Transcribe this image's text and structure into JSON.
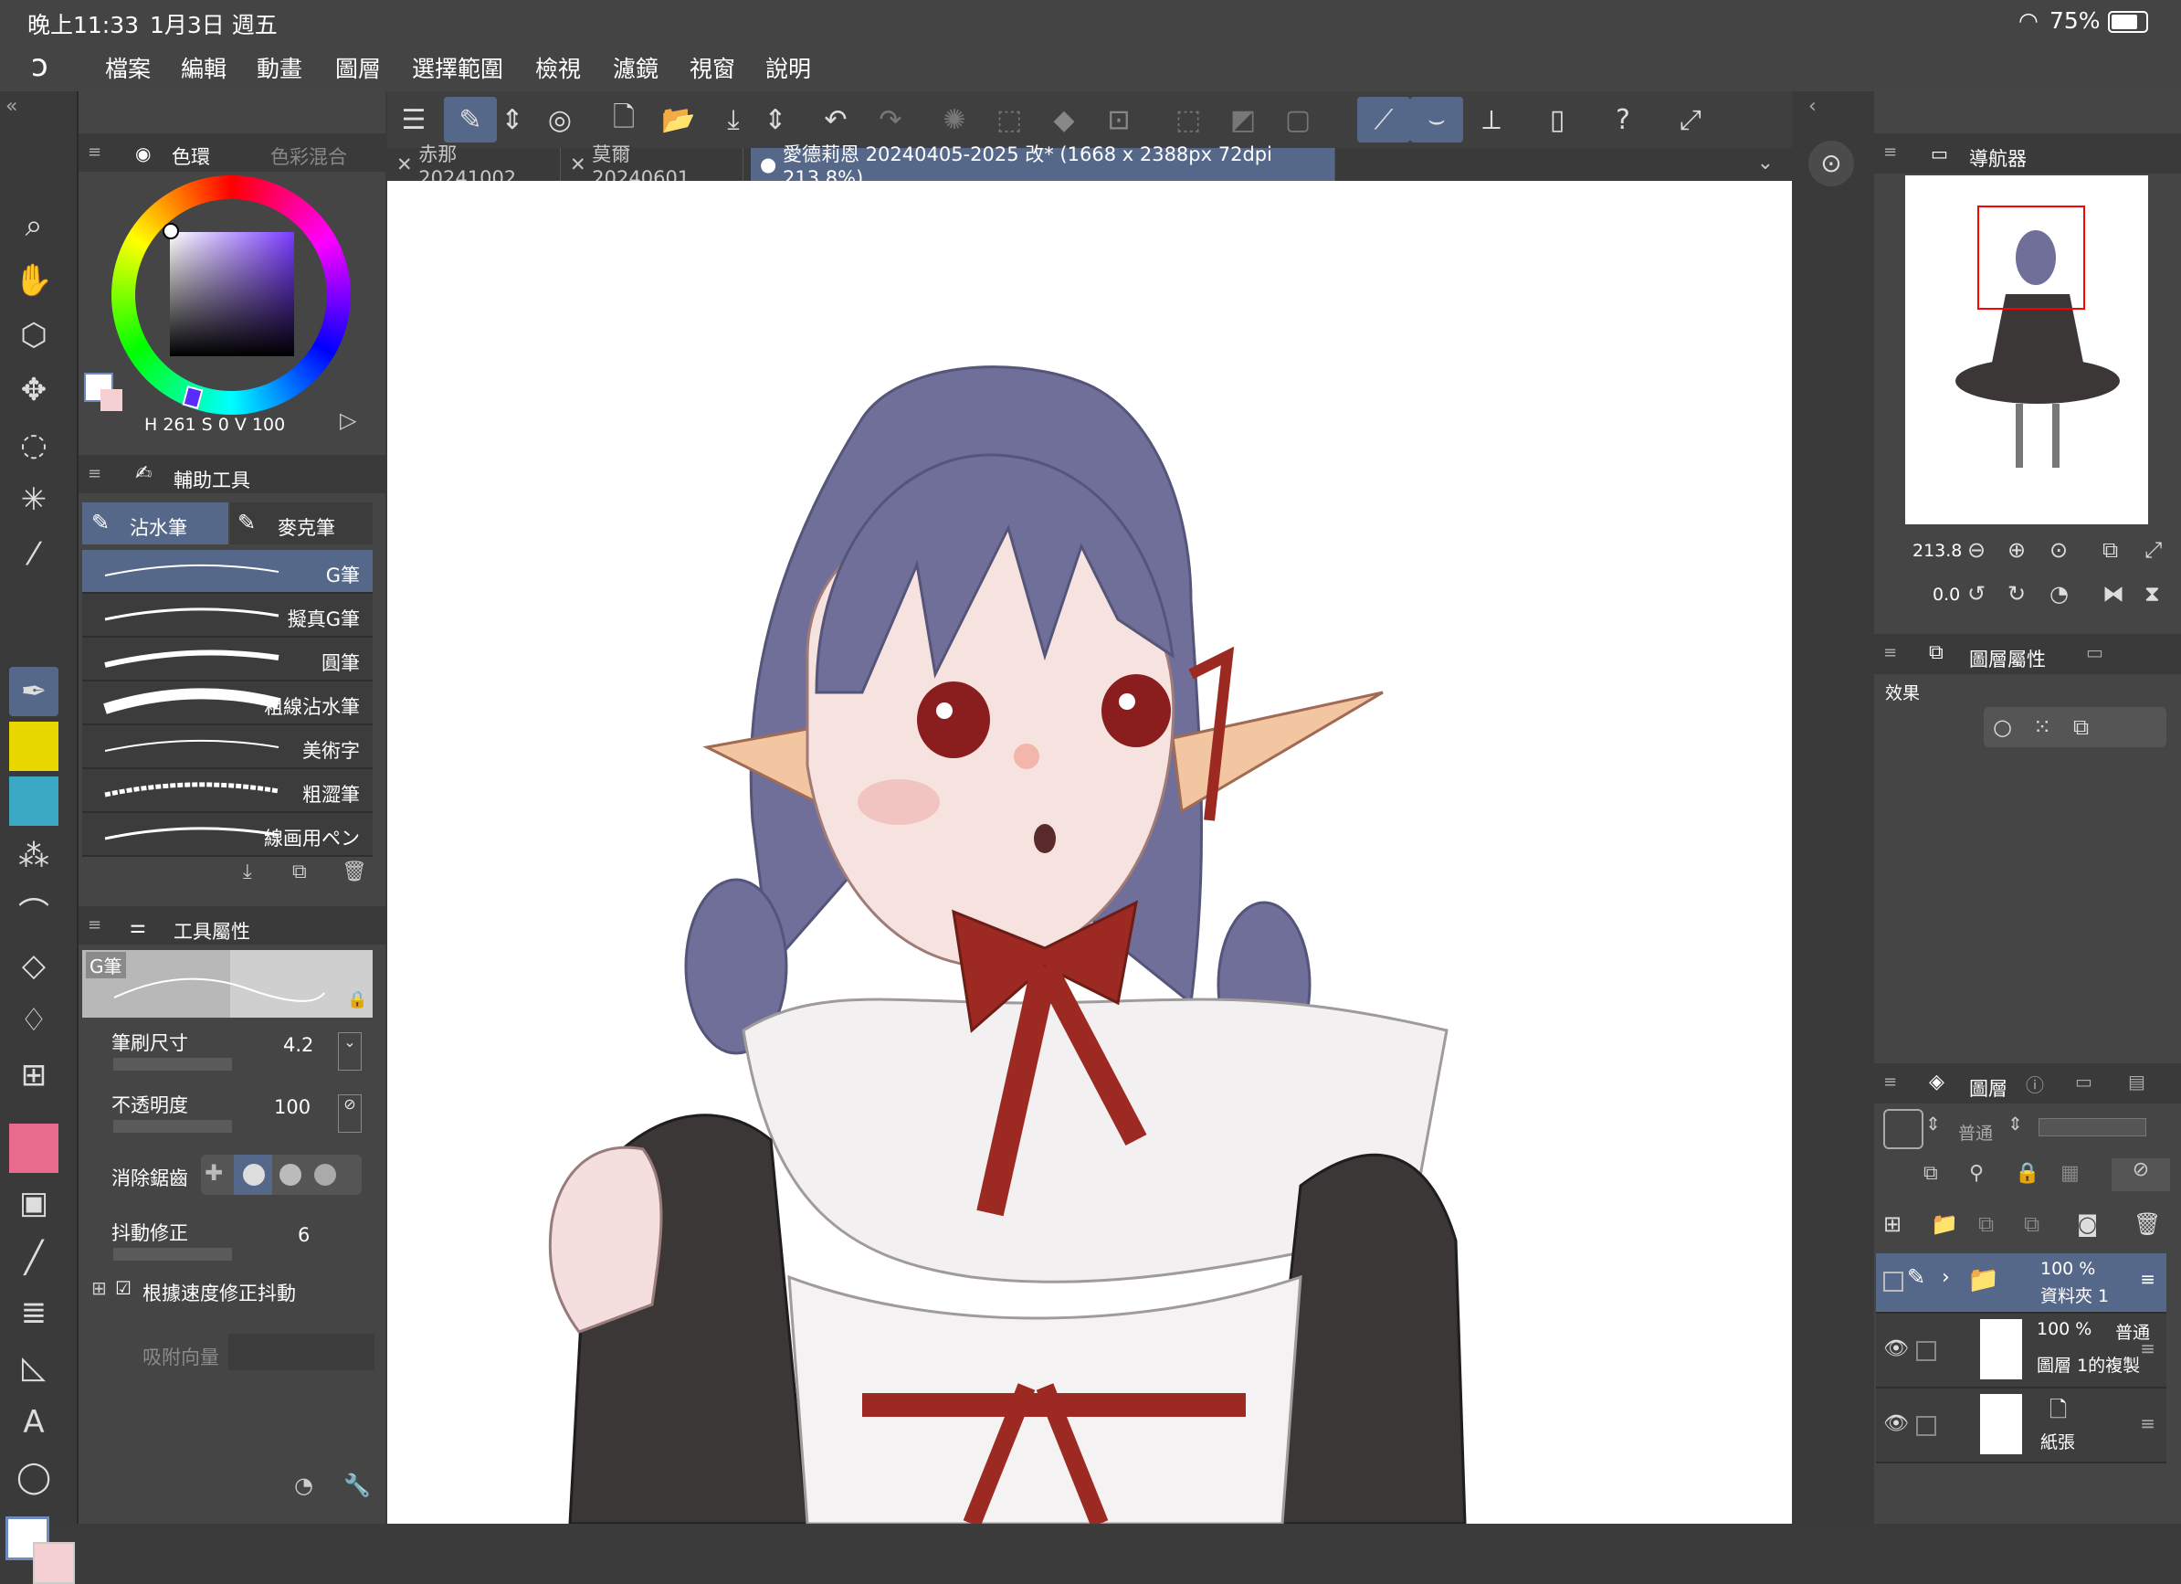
{
  "status": {
    "time": "晚上11:33",
    "date": "1月3日 週五",
    "battery": "75%"
  },
  "menu": [
    "檔案",
    "編輯",
    "動畫",
    "圖層",
    "選擇範圍",
    "檢視",
    "濾鏡",
    "視窗",
    "說明"
  ],
  "tabs": [
    {
      "label": "赤那 20241002"
    },
    {
      "label": "莫爾 20240601"
    },
    {
      "label": "愛德莉恩 20240405-2025 改* (1668 x 2388px 72dpi 213.8%)"
    }
  ],
  "color_panel": {
    "tab_active": "色環",
    "tab_inactive": "色彩混合",
    "h_label": "H",
    "h_value": "261",
    "s_label": "S",
    "s_value": "0",
    "v_label": "V",
    "v_value": "100"
  },
  "subtool_panel": {
    "title": "輔助工具",
    "group_active": "沾水筆",
    "group_other": "麥克筆",
    "brushes": [
      "G筆",
      "擬真G筆",
      "圓筆",
      "粗線沾水筆",
      "美術字",
      "粗澀筆",
      "線画用ペン"
    ]
  },
  "tool_property": {
    "title": "工具屬性",
    "preview_name": "G筆",
    "brush_size_label": "筆刷尺寸",
    "brush_size_value": "4.2",
    "opacity_label": "不透明度",
    "opacity_value": "100",
    "antialias_label": "消除鋸齒",
    "stabilization_label": "抖動修正",
    "stabilization_value": "6",
    "speed_stab_label": "根據速度修正抖動",
    "snap_label": "吸附向量"
  },
  "navigator": {
    "title": "導航器",
    "zoom": "213.8",
    "rotation": "0.0"
  },
  "layer_property": {
    "title": "圖層屬性",
    "effect_label": "效果"
  },
  "layers_panel": {
    "title": "圖層",
    "blend_mode": "普通",
    "layers": [
      {
        "opacity": "100 %",
        "name": "資料夾 1"
      },
      {
        "opacity": "100 %",
        "mode": "普通",
        "name": "圖層 1的複製"
      },
      {
        "name": "紙張"
      }
    ]
  },
  "colors": {
    "accent": "#56688a",
    "panel": "#454545",
    "bg": "#3b3b3b"
  }
}
